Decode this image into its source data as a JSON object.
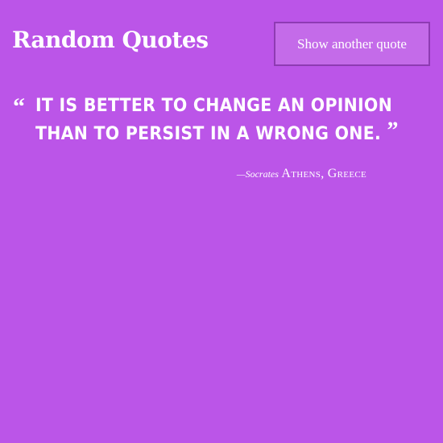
{
  "app": {
    "title": "Random Quotes"
  },
  "controls": {
    "show_button_label": "Show another quote"
  },
  "quote": {
    "open_mark": "“",
    "text": "It is better to change an opinion than to persist in a wrong one.",
    "close_mark": "”",
    "dash": "—",
    "author": "Socrates",
    "location": "Athens, Greece"
  },
  "colors": {
    "background": "#bb55e8",
    "button_fill": "#c46be9",
    "button_border": "#8e3bb3",
    "text": "#ffffff"
  }
}
